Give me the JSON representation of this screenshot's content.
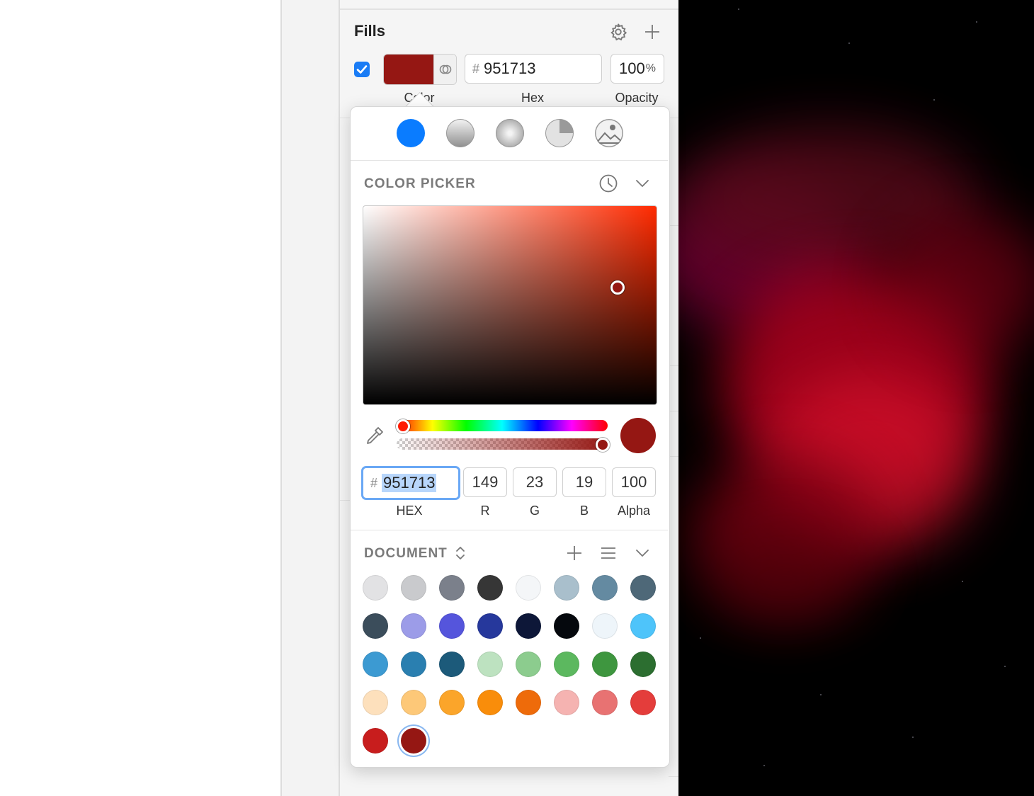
{
  "fills": {
    "title": "Fills",
    "enabled": true,
    "color": "#951713",
    "hex_hash": "#",
    "hex_value": "951713",
    "opacity_value": "100",
    "opacity_unit": "%",
    "labels": {
      "color": "Color",
      "hex": "Hex",
      "opacity": "Opacity"
    }
  },
  "fill_types": [
    {
      "name": "solid-fill-icon",
      "color": "#0a7cff"
    },
    {
      "name": "linear-gradient-icon",
      "color": "#c8c8c8"
    },
    {
      "name": "radial-gradient-icon",
      "color": "#c8c8c8"
    },
    {
      "name": "angular-gradient-icon",
      "color": "#c8c8c8"
    },
    {
      "name": "image-fill-icon",
      "color": "#c8c8c8"
    }
  ],
  "picker": {
    "title": "COLOR PICKER",
    "current_color": "#951713",
    "hash": "#",
    "hex_value": "951713",
    "r": "149",
    "g": "23",
    "b": "19",
    "alpha": "100",
    "labels": {
      "hex": "HEX",
      "r": "R",
      "g": "G",
      "b": "B",
      "alpha": "Alpha"
    }
  },
  "document": {
    "title": "DOCUMENT",
    "swatches": [
      "#e2e2e4",
      "#c9cacd",
      "#7b808b",
      "#363636",
      "#f4f6f8",
      "#a9bfcc",
      "#648aa1",
      "#4e6878",
      "#3b4d5b",
      "#9c9ce8",
      "#5555dc",
      "#26389c",
      "#0d1738",
      "#05080d",
      "#eef5fa",
      "#4ec4fa",
      "#3c9ad2",
      "#2a7fb0",
      "#1c5a7a",
      "#bde2c0",
      "#8ccc8e",
      "#5cb85f",
      "#3e963f",
      "#2c6e30",
      "#fde0bc",
      "#fdc878",
      "#fba52a",
      "#f98d0a",
      "#ee6b0a",
      "#f5b3b1",
      "#e87272",
      "#e43d3b",
      "#c81d1d",
      "#951713"
    ],
    "selected_index": 33
  }
}
